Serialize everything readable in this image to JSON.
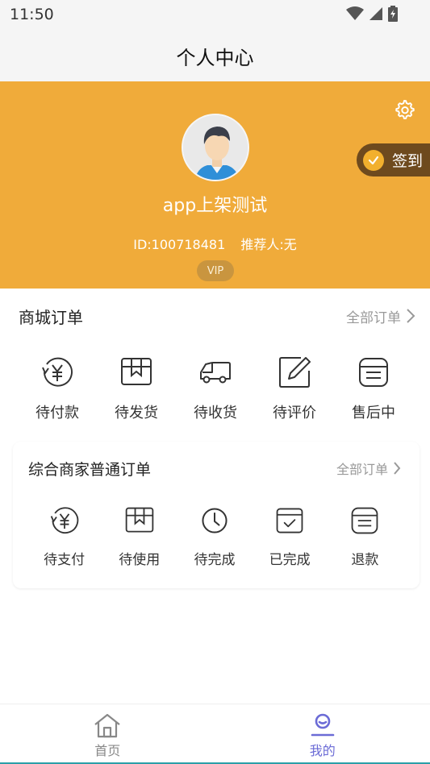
{
  "status_bar": {
    "time": "11:50"
  },
  "nav": {
    "title": "个人中心"
  },
  "profile": {
    "username": "app上架测试",
    "id_text": "ID:100718481",
    "referrer_text": "推荐人:无",
    "badge": "VIP",
    "signin_label": "签到",
    "background_color": "#f0ab3a"
  },
  "mall_orders": {
    "title": "商城订单",
    "view_all": "全部订单",
    "items": [
      {
        "label": "待付款",
        "icon": "yen-circle-icon"
      },
      {
        "label": "待发货",
        "icon": "package-icon"
      },
      {
        "label": "待收货",
        "icon": "truck-icon"
      },
      {
        "label": "待评价",
        "icon": "edit-icon"
      },
      {
        "label": "售后中",
        "icon": "list-icon"
      }
    ]
  },
  "merchant_orders": {
    "title": "综合商家普通订单",
    "view_all": "全部订单",
    "items": [
      {
        "label": "待支付",
        "icon": "yen-circle-icon"
      },
      {
        "label": "待使用",
        "icon": "package-icon"
      },
      {
        "label": "待完成",
        "icon": "clock-icon"
      },
      {
        "label": "已完成",
        "icon": "calendar-check-icon"
      },
      {
        "label": "退款",
        "icon": "list-icon"
      }
    ]
  },
  "tabbar": {
    "items": [
      {
        "label": "首页",
        "icon": "home-icon",
        "active": false
      },
      {
        "label": "我的",
        "icon": "user-icon",
        "active": true
      }
    ],
    "active_color": "#6b6bd6",
    "inactive_color": "#888888"
  }
}
